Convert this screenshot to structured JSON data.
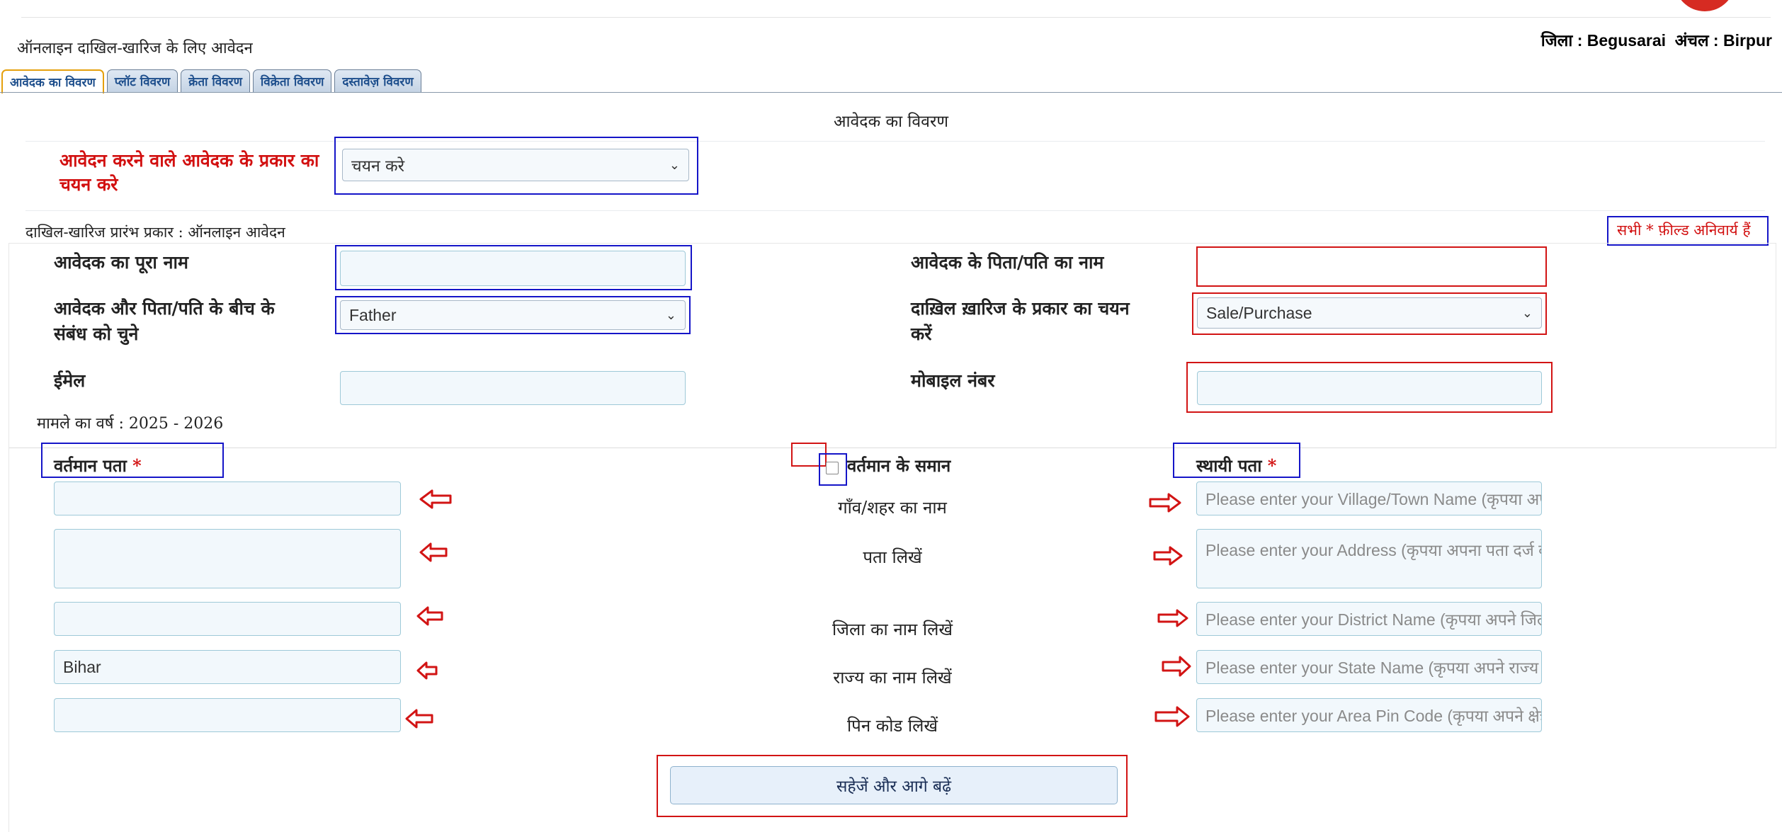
{
  "header": {
    "title": "ऑनलाइन दाखिल-खारिज के लिए आवेदन",
    "district_label": "जिला : Begusarai  अंचल : Birpur"
  },
  "tabs": [
    {
      "label": "आवेदक का विवरण",
      "active": true
    },
    {
      "label": "प्लॉट विवरण",
      "active": false
    },
    {
      "label": "क्रेता विवरण",
      "active": false
    },
    {
      "label": "विक्रेता विवरण",
      "active": false
    },
    {
      "label": "दस्तावेज़ विवरण",
      "active": false
    }
  ],
  "section": {
    "title": "आवेदक का विवरण",
    "applicant_type_label": "आवेदन करने वाले आवेदक के प्रकार का चयन करे",
    "applicant_type_value": "चयन करे",
    "initiation_type": "दाखिल-खारिज प्रारंभ प्रकार : ऑनलाइन आवेदन",
    "mandatory_note": "सभी * फ़ील्ड अनिवार्य हैं"
  },
  "form": {
    "full_name_label": "आवेदक का पूरा नाम",
    "full_name_value": "",
    "father_name_label": "आवेदक के पिता/पति का नाम",
    "father_name_value": "",
    "relation_label": "आवेदक और पिता/पति के बीच के संबंध को चुने",
    "relation_value": "Father",
    "mutation_type_label": "दाख़िल ख़ारिज के प्रकार का चयन करें",
    "mutation_type_value": "Sale/Purchase",
    "email_label": "ईमेल",
    "email_value": "",
    "mobile_label": "मोबाइल नंबर",
    "mobile_value": "",
    "case_year": "मामले का वर्ष : 2025 - 2026"
  },
  "address": {
    "current_label": "वर्तमान पता",
    "same_as_label": "वर्तमान के समान",
    "permanent_label": "स्थायी पता",
    "required_mark": "*",
    "rows": [
      {
        "label": "गाँव/शहर का नाम",
        "current_value": "",
        "permanent_placeholder": "Please enter your Village/Town Name (कृपया अपने गाँव/शहर का नाम दर्ज करें)"
      },
      {
        "label": "पता लिखें",
        "current_value": "",
        "permanent_placeholder": "Please enter your Address (कृपया अपना पता दर्ज करें)"
      },
      {
        "label": "जिला का नाम लिखें",
        "current_value": "",
        "permanent_placeholder": "Please enter your District Name (कृपया अपने जिले का नाम दर्ज करें)"
      },
      {
        "label": "राज्य का नाम लिखें",
        "current_value": "Bihar",
        "permanent_placeholder": "Please enter your State Name (कृपया अपने राज्य का नाम दर्ज करें)"
      },
      {
        "label": "पिन कोड लिखें",
        "current_value": "",
        "permanent_placeholder": "Please enter your Area Pin Code (कृपया अपने क्षेत्र का पिन कोड दर्ज करें)"
      }
    ]
  },
  "actions": {
    "save_next_label": "सहेजें और आगे बढ़ें"
  },
  "colors": {
    "annotation_blue": "#1515c8",
    "annotation_red": "#d21414",
    "tab_text": "#1d4e8c",
    "required_red": "#d21010"
  }
}
